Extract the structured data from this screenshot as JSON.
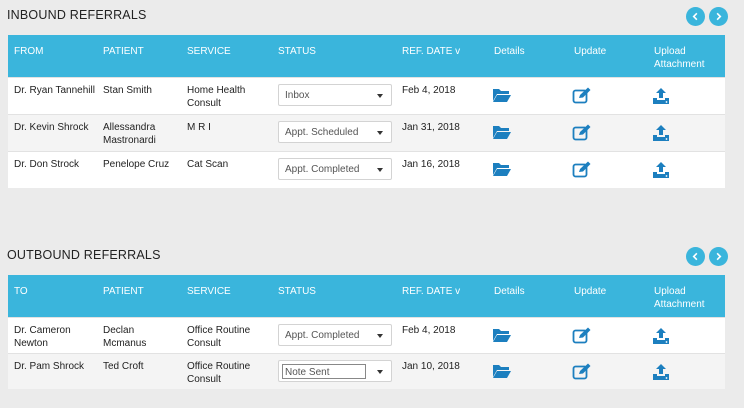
{
  "inbound": {
    "title": "INBOUND REFERRALS",
    "headers": {
      "from": "FROM",
      "patient": "PATIENT",
      "service": "SERVICE",
      "status": "STATUS",
      "ref_date": "REF. DATE  v",
      "details": "Details",
      "update": "Update",
      "upload_line1": "Upload",
      "upload_line2": "Attachment"
    },
    "rows": [
      {
        "from": "Dr. Ryan Tannehill",
        "from2": "",
        "patient": "Stan Smith",
        "patient2": "",
        "service": "Home Health",
        "service2": "Consult",
        "status": "Inbox",
        "date": "Feb 4, 2018"
      },
      {
        "from": "Dr. Kevin Shrock",
        "from2": "",
        "patient": "Allessandra",
        "patient2": "Mastronardi",
        "service": "M R I",
        "service2": "",
        "status": "Appt. Scheduled",
        "date": "Jan 31, 2018"
      },
      {
        "from": "Dr. Don Strock",
        "from2": "",
        "patient": "Penelope Cruz",
        "patient2": "",
        "service": "Cat Scan",
        "service2": "",
        "status": "Appt. Completed",
        "date": "Jan 16, 2018"
      }
    ]
  },
  "outbound": {
    "title": "OUTBOUND REFERRALS",
    "headers": {
      "from": "TO",
      "patient": "PATIENT",
      "service": "SERVICE",
      "status": "STATUS",
      "ref_date": "REF. DATE  v",
      "details": "Details",
      "update": "Update",
      "upload_line1": "Upload",
      "upload_line2": "Attachment"
    },
    "rows": [
      {
        "from": "Dr. Cameron",
        "from2": "Newton",
        "patient": "Declan",
        "patient2": "Mcmanus",
        "service": "Office Routine",
        "service2": "Consult",
        "status": "Appt. Completed",
        "date": "Feb 4, 2018"
      },
      {
        "from": "Dr. Pam Shrock",
        "from2": "",
        "patient": "Ted Croft",
        "patient2": "",
        "service": "Office Routine",
        "service2": "Consult",
        "status": "Note Sent",
        "date": "Jan 10, 2018"
      }
    ]
  },
  "icons": {
    "prev": "chevron-left-icon",
    "next": "chevron-right-icon",
    "details": "folder-open-icon",
    "update": "edit-icon",
    "upload": "upload-icon"
  },
  "colors": {
    "accent": "#3ab5dc",
    "icon": "#1c7fbf",
    "background": "#ebebeb"
  }
}
